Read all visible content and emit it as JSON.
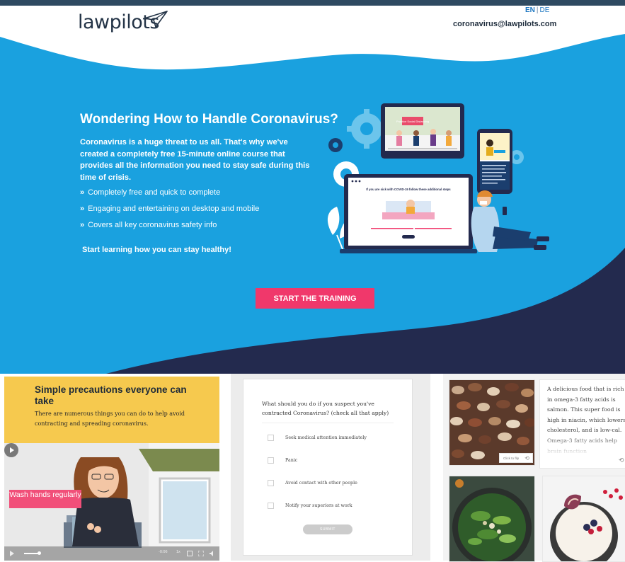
{
  "header": {
    "logo_text": "lawpilots",
    "lang_en": "EN",
    "lang_sep": "|",
    "lang_de": "DE",
    "email": "coronavirus@lawpilots.com"
  },
  "hero": {
    "title": "Wondering How to Handle Coronavirus?",
    "description": "Coronavirus is a huge threat to us all. That's why we've created a completely free 15-minute online course that provides all the information you need to stay safe during this time of crisis.",
    "features": [
      "Completely free and quick to complete",
      "Engaging and entertaining on desktop and mobile",
      "Covers all key coronavirus safety info"
    ],
    "cta_line": "Start learning how you can stay healthy!",
    "button_label": "START THE TRAINING"
  },
  "illustration": {
    "tablet_label": "Practice Social Distancing",
    "laptop_heading": "If you are sick with COVID-19 follow these additional steps",
    "phone_text": "Social distancing, hand washing, and being careful coughing and sneezing are the most effective measures against the spread of coronavirus."
  },
  "panel_precautions": {
    "title": "Simple precautions everyone can take",
    "text": "There are numerous things you can do to help avoid contracting and spreading coronavirus.",
    "video_label": "Wash hands regularly",
    "video_time": "-0:06",
    "video_speed": "1x"
  },
  "panel_quiz": {
    "question": "What should you do if you suspect you've contracted Coronavirus? (check all that apply)",
    "options": [
      "Seek medical attention immediately",
      "Panic",
      "Avoid contact with other people",
      "Notify your superiors at work"
    ],
    "submit_label": "SUBMIT"
  },
  "panel_food": {
    "salmon_text": "A delicious food that is rich in omega-3 fatty acids is salmon. This super food is high in niacin, which lowers cholesterol, and is low-cal. Omega-3 fatty acids help brain function",
    "flip_label": "Click to flip"
  },
  "colors": {
    "hero_blue": "#1aa1df",
    "navy": "#232a4e",
    "accent_pink": "#f0386b",
    "panel_yellow": "#f6c94e"
  }
}
